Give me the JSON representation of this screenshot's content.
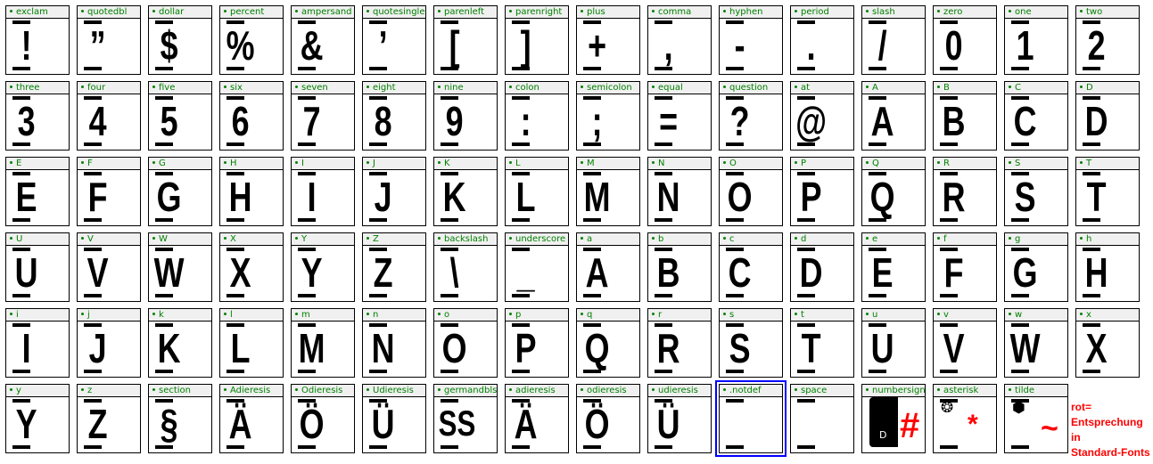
{
  "cells": [
    {
      "name": "exclam",
      "glyph": "!"
    },
    {
      "name": "quotedbl",
      "glyph": "”"
    },
    {
      "name": "dollar",
      "glyph": "$"
    },
    {
      "name": "percent",
      "glyph": "%"
    },
    {
      "name": "ampersand",
      "glyph": "&"
    },
    {
      "name": "quotesingle",
      "glyph": "’"
    },
    {
      "name": "parenleft",
      "glyph": "["
    },
    {
      "name": "parenright",
      "glyph": "]"
    },
    {
      "name": "plus",
      "glyph": "+"
    },
    {
      "name": "comma",
      "glyph": ","
    },
    {
      "name": "hyphen",
      "glyph": "-"
    },
    {
      "name": "period",
      "glyph": "."
    },
    {
      "name": "slash",
      "glyph": "/"
    },
    {
      "name": "zero",
      "glyph": "0"
    },
    {
      "name": "one",
      "glyph": "1"
    },
    {
      "name": "two",
      "glyph": "2"
    },
    {
      "name": "three",
      "glyph": "3"
    },
    {
      "name": "four",
      "glyph": "4"
    },
    {
      "name": "five",
      "glyph": "5"
    },
    {
      "name": "six",
      "glyph": "6"
    },
    {
      "name": "seven",
      "glyph": "7"
    },
    {
      "name": "eight",
      "glyph": "8"
    },
    {
      "name": "nine",
      "glyph": "9"
    },
    {
      "name": "colon",
      "glyph": ":"
    },
    {
      "name": "semicolon",
      "glyph": ";"
    },
    {
      "name": "equal",
      "glyph": "="
    },
    {
      "name": "question",
      "glyph": "?"
    },
    {
      "name": "at",
      "glyph": "@"
    },
    {
      "name": "A",
      "glyph": "A"
    },
    {
      "name": "B",
      "glyph": "B"
    },
    {
      "name": "C",
      "glyph": "C"
    },
    {
      "name": "D",
      "glyph": "D"
    },
    {
      "name": "E",
      "glyph": "E"
    },
    {
      "name": "F",
      "glyph": "F"
    },
    {
      "name": "G",
      "glyph": "G"
    },
    {
      "name": "H",
      "glyph": "H"
    },
    {
      "name": "I",
      "glyph": "I"
    },
    {
      "name": "J",
      "glyph": "J"
    },
    {
      "name": "K",
      "glyph": "K"
    },
    {
      "name": "L",
      "glyph": "L"
    },
    {
      "name": "M",
      "glyph": "M"
    },
    {
      "name": "N",
      "glyph": "N"
    },
    {
      "name": "O",
      "glyph": "O"
    },
    {
      "name": "P",
      "glyph": "P"
    },
    {
      "name": "Q",
      "glyph": "Q"
    },
    {
      "name": "R",
      "glyph": "R"
    },
    {
      "name": "S",
      "glyph": "S"
    },
    {
      "name": "T",
      "glyph": "T"
    },
    {
      "name": "U",
      "glyph": "U"
    },
    {
      "name": "V",
      "glyph": "V"
    },
    {
      "name": "W",
      "glyph": "W"
    },
    {
      "name": "X",
      "glyph": "X"
    },
    {
      "name": "Y",
      "glyph": "Y"
    },
    {
      "name": "Z",
      "glyph": "Z"
    },
    {
      "name": "backslash",
      "glyph": "\\"
    },
    {
      "name": "underscore",
      "glyph": "_"
    },
    {
      "name": "a",
      "glyph": "A"
    },
    {
      "name": "b",
      "glyph": "B"
    },
    {
      "name": "c",
      "glyph": "C"
    },
    {
      "name": "d",
      "glyph": "D"
    },
    {
      "name": "e",
      "glyph": "E"
    },
    {
      "name": "f",
      "glyph": "F"
    },
    {
      "name": "g",
      "glyph": "G"
    },
    {
      "name": "h",
      "glyph": "H"
    },
    {
      "name": "i",
      "glyph": "I"
    },
    {
      "name": "j",
      "glyph": "J"
    },
    {
      "name": "k",
      "glyph": "K"
    },
    {
      "name": "l",
      "glyph": "L"
    },
    {
      "name": "m",
      "glyph": "M"
    },
    {
      "name": "n",
      "glyph": "N"
    },
    {
      "name": "o",
      "glyph": "O"
    },
    {
      "name": "p",
      "glyph": "P"
    },
    {
      "name": "q",
      "glyph": "Q"
    },
    {
      "name": "r",
      "glyph": "R"
    },
    {
      "name": "s",
      "glyph": "S"
    },
    {
      "name": "t",
      "glyph": "T"
    },
    {
      "name": "u",
      "glyph": "U"
    },
    {
      "name": "v",
      "glyph": "V"
    },
    {
      "name": "w",
      "glyph": "W"
    },
    {
      "name": "x",
      "glyph": "X"
    },
    {
      "name": "y",
      "glyph": "Y"
    },
    {
      "name": "z",
      "glyph": "Z"
    },
    {
      "name": "section",
      "glyph": "§"
    },
    {
      "name": "Adieresis",
      "glyph": "Ä"
    },
    {
      "name": "Odieresis",
      "glyph": "Ö"
    },
    {
      "name": "Udieresis",
      "glyph": "Ü"
    },
    {
      "name": "germandbls",
      "glyph": "SS"
    },
    {
      "name": "adieresis",
      "glyph": "Ä"
    },
    {
      "name": "odieresis",
      "glyph": "Ö"
    },
    {
      "name": "udieresis",
      "glyph": "Ü"
    },
    {
      "name": ".notdef",
      "glyph": "",
      "selected": true
    },
    {
      "name": "space",
      "glyph": ""
    },
    {
      "name": "numbersign",
      "glyph": "",
      "special": "block",
      "block_label": "D",
      "red": "#"
    },
    {
      "name": "asterisk",
      "glyph": "",
      "special": "icon",
      "icon": "wheel-icon",
      "red": "*"
    },
    {
      "name": "tilde",
      "glyph": "",
      "special": "icon",
      "icon": "hex-wheel-icon",
      "red": "~"
    }
  ],
  "note": [
    "rot=",
    "Entsprechung in",
    "Standard-Fonts"
  ],
  "colors": {
    "label": "#008000",
    "selection": "#0000ff",
    "standard_font": "#ff0000"
  }
}
